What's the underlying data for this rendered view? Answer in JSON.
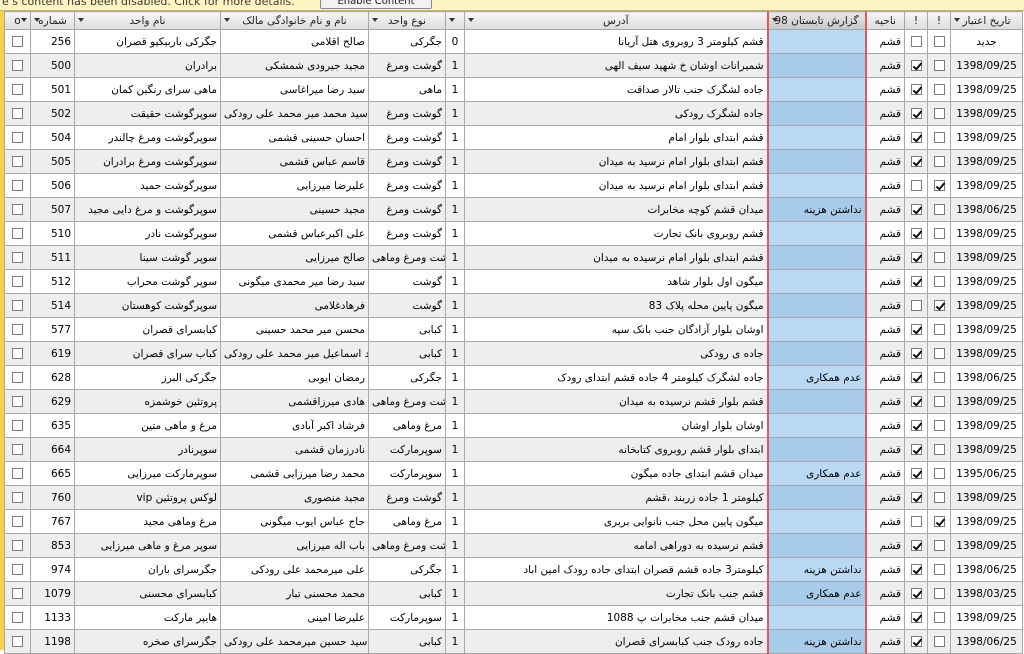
{
  "security_bar": {
    "message": "e s content has been disabled. Click for more details.",
    "enable_button": "Enable Content"
  },
  "columns": {
    "select": "o",
    "number": "شماره",
    "unit_name": "نام واحد",
    "owner": "نام و نام خانوادگی مالک",
    "unit_type": "نوع واحد",
    "flag": "",
    "address": "آدرس",
    "report": "گزارش تابستان 98",
    "region": "ناحیه",
    "c1": "!",
    "c2": "!",
    "expiry": "تاریخ اعتبار"
  },
  "rows": [
    {
      "num": "256",
      "unit": "جگرکی باربیکیو قصران",
      "owner": "صالح اقلامی",
      "type": "جگرکی",
      "flag": "0",
      "addr": "قشم کیلومتر 3 روبروی هتل آریانا",
      "rep": "",
      "city": "قشم",
      "c1": false,
      "c2": false,
      "date": "جدید"
    },
    {
      "num": "500",
      "unit": "برادران",
      "owner": "مجید جیرودی شمشکی",
      "type": "گوشت ومرغ",
      "flag": "1",
      "addr": "شمیرانات اوشان خ شهید سیف الهی",
      "rep": "",
      "city": "قشم",
      "c1": true,
      "c2": false,
      "date": "1398/09/25"
    },
    {
      "num": "501",
      "unit": "ماهی سرای رنگین کمان",
      "owner": "سید رضا میراغاسی",
      "type": "ماهی",
      "flag": "1",
      "addr": "جاده لشگرک جنب تالار صداقت",
      "rep": "",
      "city": "قشم",
      "c1": true,
      "c2": false,
      "date": "1398/09/25"
    },
    {
      "num": "502",
      "unit": "سوپرگوشت حقیقت",
      "owner": "سید محمد میر محمد علی رودکی",
      "type": "گوشت ومرغ",
      "flag": "1",
      "addr": "جاده لشگرک رودکی",
      "rep": "",
      "city": "قشم",
      "c1": true,
      "c2": false,
      "date": "1398/09/25"
    },
    {
      "num": "504",
      "unit": "سوپرگوشت ومرغ چالندر",
      "owner": "احسان حسینی قشمی",
      "type": "گوشت ومرغ",
      "flag": "1",
      "addr": "قشم ابتدای بلوار امام",
      "rep": "",
      "city": "قشم",
      "c1": true,
      "c2": false,
      "date": "1398/09/25"
    },
    {
      "num": "505",
      "unit": "سوپرگوشت ومرغ برادران",
      "owner": "قاسم عباس قشمی",
      "type": "گوشت ومرغ",
      "flag": "1",
      "addr": "قشم ابتدای بلوار امام نرسید به میدان",
      "rep": "",
      "city": "قشم",
      "c1": true,
      "c2": false,
      "date": "1398/09/25"
    },
    {
      "num": "506",
      "unit": "سوپرگوشت حمید",
      "owner": "علیرضا میرزایی",
      "type": "گوشت ومرغ",
      "flag": "1",
      "addr": "قشم ابتدای بلوار امام نرسید به میدان",
      "rep": "",
      "city": "قشم",
      "c1": false,
      "c2": true,
      "date": "1398/09/25"
    },
    {
      "num": "507",
      "unit": "سوپرگوشت و مرغ دایی مجید",
      "owner": "مجید حسینی",
      "type": "گوشت ومرغ",
      "flag": "1",
      "addr": "میدان قشم کوچه مخابرات",
      "rep": "نداشتن هزینه",
      "city": "قشم",
      "c1": true,
      "c2": false,
      "date": "1398/06/25"
    },
    {
      "num": "510",
      "unit": "سوپرگوشت نادر",
      "owner": "علی اکبرعباس قشمی",
      "type": "گوشت ومرغ",
      "flag": "1",
      "addr": "قشم روبروی بانک تجارت",
      "rep": "",
      "city": "قشم",
      "c1": true,
      "c2": false,
      "date": "1398/09/25"
    },
    {
      "num": "511",
      "unit": "سوپر گوشت سینا",
      "owner": "صالح میرزایی",
      "type": "گوشت ومرغ وماهی",
      "flag": "1",
      "addr": "قشم ابتدای بلوار امام نرسیده به میدان",
      "rep": "",
      "city": "قشم",
      "c1": true,
      "c2": false,
      "date": "1398/09/25"
    },
    {
      "num": "512",
      "unit": "سوپر گوشت محراب",
      "owner": "سید رضا میر محمدی میگونی",
      "type": "گوشت",
      "flag": "1",
      "addr": "میگون اول بلوار شاهد",
      "rep": "",
      "city": "قشم",
      "c1": true,
      "c2": false,
      "date": "1398/09/25"
    },
    {
      "num": "514",
      "unit": "سوپرگوشت کوهستان",
      "owner": "فرهادغلامی",
      "type": "گوشت",
      "flag": "1",
      "addr": "میگون پایین محله پلاک 83",
      "rep": "",
      "city": "قشم",
      "c1": false,
      "c2": true,
      "date": "1398/09/25"
    },
    {
      "num": "577",
      "unit": "کبابسرای قصران",
      "owner": "محسن میر محمد حسینی",
      "type": "کبابی",
      "flag": "1",
      "addr": "اوشان بلوار آزادگان جنب بانک سپه",
      "rep": "",
      "city": "قشم",
      "c1": true,
      "c2": false,
      "date": "1398/09/25"
    },
    {
      "num": "619",
      "unit": "کباب سرای قصران",
      "owner": "سید اسماعیل میر محمد علی رودکی",
      "type": "کبابی",
      "flag": "1",
      "addr": "جاده ی رودکی",
      "rep": "",
      "city": "قشم",
      "c1": true,
      "c2": false,
      "date": "1398/09/25"
    },
    {
      "num": "628",
      "unit": "جگرکی البرز",
      "owner": "رمضان ایوبی",
      "type": "جگرکی",
      "flag": "1",
      "addr": "جاده لشگرک کیلومتر 4 جاده قشم ابتدای رودک",
      "rep": "عدم همکاری",
      "city": "قشم",
      "c1": true,
      "c2": false,
      "date": "1398/06/25"
    },
    {
      "num": "629",
      "unit": "پروتئین خوشمزه",
      "owner": "هادی میرزاقشمی",
      "type": "گوشت ومرغ وماهی",
      "flag": "1",
      "addr": "قشم بلوار قشم نرسیده به میدان",
      "rep": "",
      "city": "قشم",
      "c1": true,
      "c2": false,
      "date": "1398/09/25"
    },
    {
      "num": "635",
      "unit": "مرغ و ماهی متین",
      "owner": "فرشاد اکبر آبادی",
      "type": "مرغ وماهی",
      "flag": "1",
      "addr": "اوشان بلوار اوشان",
      "rep": "",
      "city": "قشم",
      "c1": true,
      "c2": false,
      "date": "1398/09/25"
    },
    {
      "num": "664",
      "unit": "سوپرنادر",
      "owner": "نادرزمان قشمی",
      "type": "سوپرمارکت",
      "flag": "1",
      "addr": "ابتدای بلوار قشم روبروی کتابخانه",
      "rep": "",
      "city": "قشم",
      "c1": true,
      "c2": false,
      "date": "1398/09/25"
    },
    {
      "num": "665",
      "unit": "سوپرمارکت میرزایی",
      "owner": "محمد رضا میرزایی قشمی",
      "type": "سوپرمارکت",
      "flag": "1",
      "addr": "میدان قشم ابتدای جاده میگون",
      "rep": "عدم همکاری",
      "city": "قشم",
      "c1": true,
      "c2": false,
      "date": "1395/06/25"
    },
    {
      "num": "760",
      "unit": "vip لوکس پروتئین",
      "owner": "مجید منصوری",
      "type": "گوشت ومرغ",
      "flag": "1",
      "addr": "کیلومتر 1 جاده زربند ،قشم",
      "rep": "",
      "city": "قشم",
      "c1": true,
      "c2": false,
      "date": "1398/09/25"
    },
    {
      "num": "767",
      "unit": "مرغ وماهی مجید",
      "owner": "حاج عباس ایوب میگونی",
      "type": "مرغ وماهی",
      "flag": "1",
      "addr": "میگون پایین محل جنب نانوایی بربری",
      "rep": "",
      "city": "قشم",
      "c1": false,
      "c2": true,
      "date": "1398/09/25"
    },
    {
      "num": "853",
      "unit": "سوپر مرغ و ماهی میرزایی",
      "owner": "باب اله میرزایی",
      "type": "گوشت ومرغ وماهی",
      "flag": "1",
      "addr": "قشم نرسیده به دوراهی امامه",
      "rep": "",
      "city": "قشم",
      "c1": true,
      "c2": false,
      "date": "1398/09/25"
    },
    {
      "num": "974",
      "unit": "جگرسرای باران",
      "owner": "علی میرمحمد علی رودکی",
      "type": "جگرکی",
      "flag": "1",
      "addr": "کیلومتر3 جاده قشم قصران ابتدای جاده رودک امین اباد",
      "rep": "نداشتن هزینه",
      "city": "قشم",
      "c1": true,
      "c2": false,
      "date": "1398/06/25"
    },
    {
      "num": "1079",
      "unit": "کبابسرای محسنی",
      "owner": "محمد محسنی تبار",
      "type": "کبابی",
      "flag": "1",
      "addr": "قشم جنب بانک تجارت",
      "rep": "عدم همکاری",
      "city": "قشم",
      "c1": true,
      "c2": false,
      "date": "1398/03/25"
    },
    {
      "num": "1133",
      "unit": "هایپر مارکت",
      "owner": "علیرضا امینی",
      "type": "سوپرمارکت",
      "flag": "1",
      "addr": "میدان قشم جنب مخابرات پ 1088",
      "rep": "",
      "city": "قشم",
      "c1": true,
      "c2": false,
      "date": "1398/09/25"
    },
    {
      "num": "1198",
      "unit": "جگرسرای صخره",
      "owner": "سید حسین میرمحمد علی رودکی",
      "type": "کبابی",
      "flag": "1",
      "addr": "جاده رودک جنب کبابسرای قصران",
      "rep": "نداشتن هزینه",
      "city": "قشم",
      "c1": true,
      "c2": false,
      "date": "1398/06/25"
    }
  ]
}
